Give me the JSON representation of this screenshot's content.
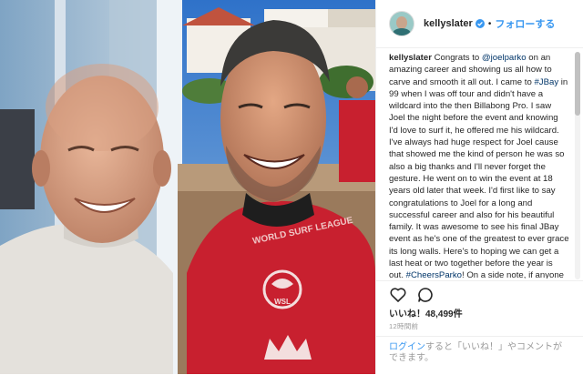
{
  "post": {
    "photo_alt": "",
    "jersey_text": "WORLD SURF LEAGUE",
    "jersey_logo": "WSL"
  },
  "header": {
    "username": "kellyslater",
    "verified_icon": "verified-badge-icon",
    "separator": "•",
    "follow_label": "フォローする"
  },
  "caption": {
    "username": "kellyslater",
    "text_1": " Congrats to ",
    "mention": "@joelparko",
    "text_2": " on an amazing career and showing us all how to carve and smooth it all out. I came to ",
    "hashtag_1": "#JBay",
    "text_3": " in 99 when I was off tour and didn't have a wildcard into the then Billabong Pro. I saw Joel the night before the event and knowing I'd love to surf it, he offered me his wildcard. I've always had huge respect for Joel cause that showed me the kind of person he was so also a big thanks and I'll never forget the gesture. He went on to win the event at 18 years old later that week. I'd first like to say congratulations to Joel for a long and successful career and also for his beautiful family. It was awesome to see his final JBay event as he's one of the greatest to ever grace its long walls. Here's to hoping we can get a last heat or two together before the year is out. ",
    "hashtag_2": "#CheersParko",
    "text_4": "! On a side note, if anyone"
  },
  "actions": {
    "like_icon": "heart-icon",
    "comment_icon": "comment-icon",
    "likes_label": "いいね！48,499件",
    "timestamp": "12時間前"
  },
  "login": {
    "link": "ログイン",
    "text": "すると「いいね！」やコメントができます。"
  },
  "colors": {
    "link_blue": "#3897f0",
    "hashtag_dark_blue": "#003569",
    "jersey_red": "#c8202f"
  }
}
